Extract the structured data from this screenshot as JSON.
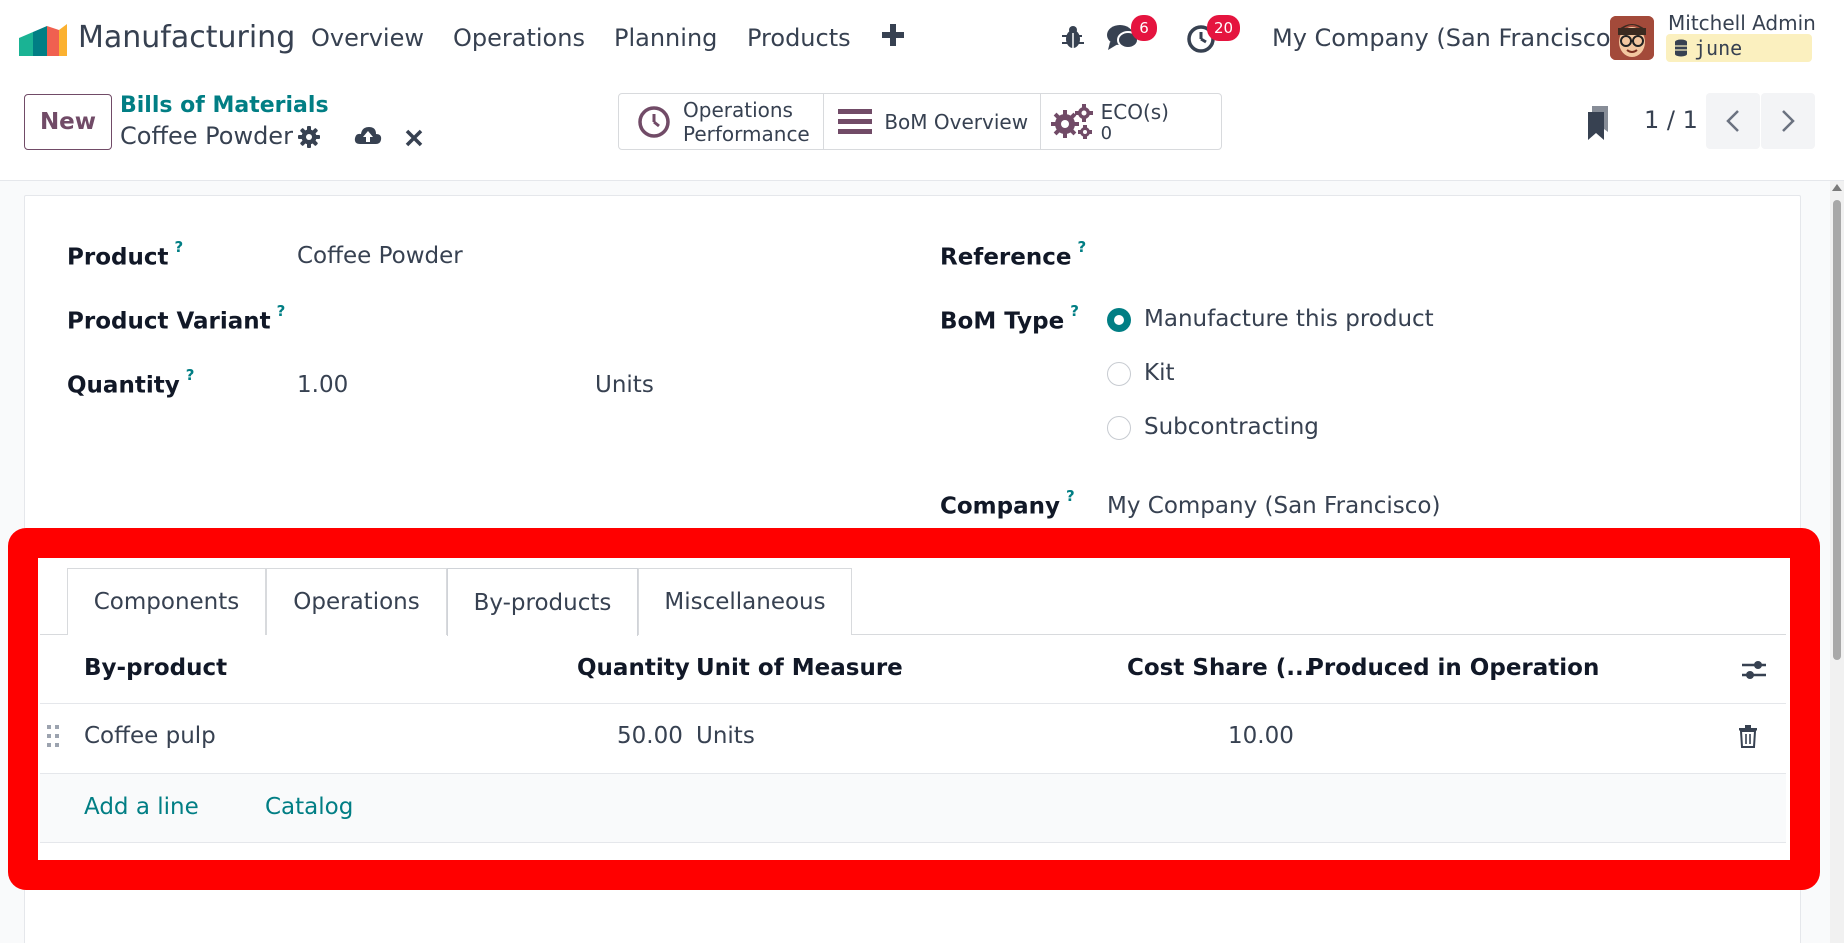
{
  "navbar": {
    "app_name": "Manufacturing",
    "menu": [
      "Overview",
      "Operations",
      "Planning",
      "Products"
    ],
    "messages_count": "6",
    "activities_count": "20",
    "company": "My Company (San Francisco)",
    "user_name": "Mitchell Admin",
    "database": "june"
  },
  "control_panel": {
    "new_label": "New",
    "breadcrumb": "Bills of Materials",
    "record_title": "Coffee Powder",
    "smart_buttons": {
      "ops_perf_line1": "Operations",
      "ops_perf_line2": "Performance",
      "bom_overview": "BoM Overview",
      "ecos_label": "ECO(s)",
      "ecos_value": "0"
    },
    "pager": "1 / 1"
  },
  "form": {
    "product_label": "Product",
    "product_value": "Coffee Powder",
    "variant_label": "Product Variant",
    "quantity_label": "Quantity",
    "quantity_value": "1.00",
    "uom_value": "Units",
    "reference_label": "Reference",
    "bom_type_label": "BoM Type",
    "bom_type_options": [
      "Manufacture this product",
      "Kit",
      "Subcontracting"
    ],
    "bom_type_selected": "Manufacture this product",
    "company_label": "Company",
    "company_value": "My Company (San Francisco)",
    "help_mark": "?"
  },
  "notebook": {
    "tabs": [
      "Components",
      "Operations",
      "By-products",
      "Miscellaneous"
    ],
    "active_tab": "By-products",
    "columns": {
      "by_product": "By-product",
      "quantity": "Quantity",
      "uom": "Unit of Measure",
      "cost_share": "Cost Share (...",
      "operation": "Produced in Operation"
    },
    "rows": [
      {
        "by_product": "Coffee pulp",
        "quantity": "50.00",
        "uom": "Units",
        "cost_share": "10.00",
        "operation": ""
      }
    ],
    "add_line": "Add a line",
    "catalog": "Catalog"
  },
  "colors": {
    "brand": "#714b67",
    "accent": "#017e84",
    "badge": "#e5143f",
    "highlight": "#ff0000"
  }
}
